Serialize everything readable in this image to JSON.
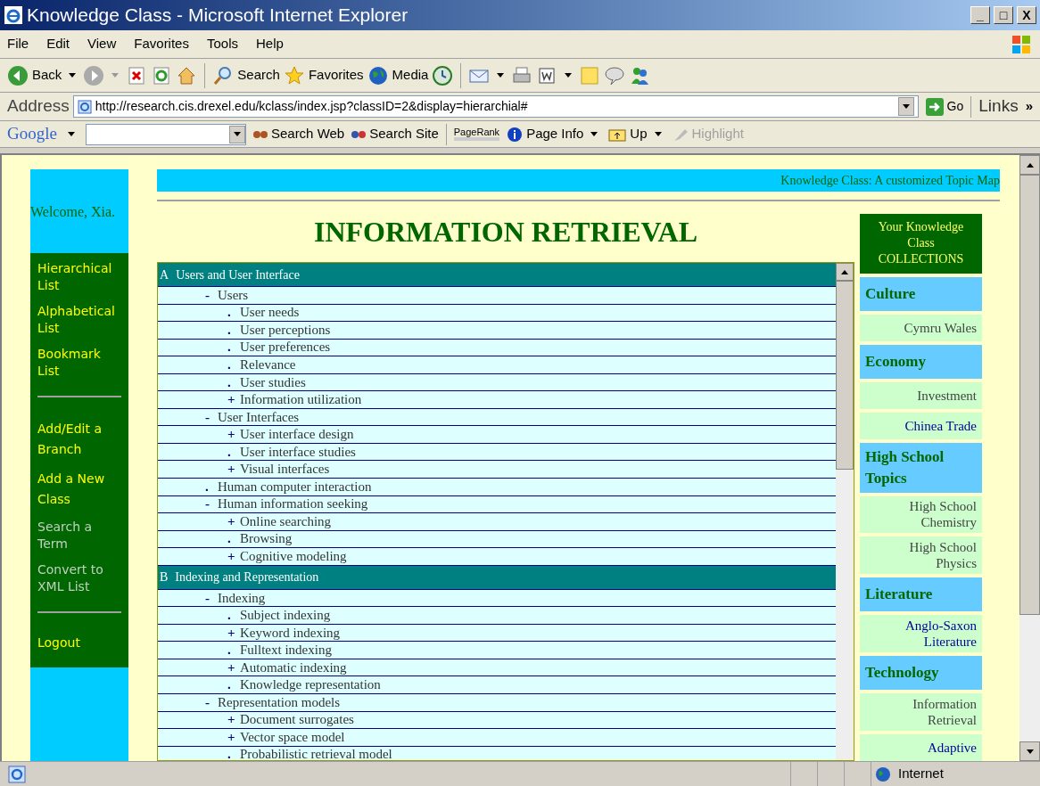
{
  "window": {
    "title": "Knowledge Class - Microsoft Internet Explorer",
    "controls": [
      "_",
      "□",
      "X"
    ]
  },
  "menu": [
    "File",
    "Edit",
    "View",
    "Favorites",
    "Tools",
    "Help"
  ],
  "toolbar": {
    "labels": [
      "Back",
      "Search",
      "Favorites",
      "Media"
    ]
  },
  "address": {
    "label": "Address",
    "url": "http://research.cis.drexel.edu/kclass/index.jsp?classID=2&display=hierarchial#",
    "go": "Go",
    "links": "Links",
    "more": "»"
  },
  "google_bar": {
    "logo": "Google",
    "items": [
      {
        "label": "Search Web",
        "disabled": false
      },
      {
        "label": "Search Site",
        "disabled": false
      },
      {
        "label": "PageRank",
        "disabled": false
      },
      {
        "label": "Page Info",
        "disabled": false
      },
      {
        "label": "Up",
        "disabled": false
      },
      {
        "label": "Highlight",
        "disabled": true
      }
    ]
  },
  "welcome": "Welcome, Xia.",
  "nav": [
    [
      {
        "label": "Hierarchical List",
        "disabled": false
      },
      {
        "label": "Alphabetical List",
        "disabled": false
      },
      {
        "label": "Bookmark List",
        "disabled": false
      }
    ],
    [
      {
        "label": "Add/Edit a Branch",
        "disabled": false
      },
      {
        "label": "Add a New Class",
        "disabled": false
      },
      {
        "label": "Search a Term",
        "disabled": true
      },
      {
        "label": "Convert to XML List",
        "disabled": true
      }
    ],
    [
      {
        "label": "Logout",
        "disabled": false
      }
    ]
  ],
  "banner": "Knowledge Class: A customized Topic Map",
  "heading": "INFORMATION RETRIEVAL",
  "tree": [
    {
      "letter": "A",
      "title": "Users and User Interface",
      "children": [
        {
          "marker": "-",
          "label": "Users",
          "children": [
            {
              "marker": ".",
              "label": "User needs"
            },
            {
              "marker": ".",
              "label": "User perceptions"
            },
            {
              "marker": ".",
              "label": "User preferences"
            },
            {
              "marker": ".",
              "label": "Relevance"
            },
            {
              "marker": ".",
              "label": "User studies"
            },
            {
              "marker": "+",
              "label": "Information utilization"
            }
          ]
        },
        {
          "marker": "-",
          "label": "User Interfaces",
          "children": [
            {
              "marker": "+",
              "label": "User interface design"
            },
            {
              "marker": ".",
              "label": "User interface studies"
            },
            {
              "marker": "+",
              "label": "Visual interfaces"
            }
          ]
        },
        {
          "marker": ".",
          "label": "Human computer interaction"
        },
        {
          "marker": "-",
          "label": "Human information seeking",
          "children": [
            {
              "marker": "+",
              "label": "Online searching"
            },
            {
              "marker": ".",
              "label": "Browsing"
            },
            {
              "marker": "+",
              "label": "Cognitive modeling"
            }
          ]
        }
      ]
    },
    {
      "letter": "B",
      "title": "Indexing and Representation",
      "children": [
        {
          "marker": "-",
          "label": "Indexing",
          "children": [
            {
              "marker": ".",
              "label": "Subject indexing"
            },
            {
              "marker": "+",
              "label": "Keyword indexing"
            },
            {
              "marker": ".",
              "label": "Fulltext indexing"
            },
            {
              "marker": "+",
              "label": "Automatic indexing"
            },
            {
              "marker": ".",
              "label": "Knowledge representation"
            }
          ]
        },
        {
          "marker": "-",
          "label": "Representation models",
          "children": [
            {
              "marker": "+",
              "label": "Document surrogates"
            },
            {
              "marker": "+",
              "label": "Vector space model"
            },
            {
              "marker": ".",
              "label": "Probabilistic retrieval model"
            }
          ]
        }
      ]
    }
  ],
  "collections": {
    "title": "Your Knowledge Class COLLECTIONS",
    "items": [
      {
        "kind": "category",
        "label": "Culture"
      },
      {
        "kind": "item",
        "label": "Cymru Wales",
        "link": false
      },
      {
        "kind": "category",
        "label": "Economy"
      },
      {
        "kind": "item",
        "label": "Investment",
        "link": false
      },
      {
        "kind": "item",
        "label": "Chinea Trade",
        "link": true
      },
      {
        "kind": "category",
        "label": "High School Topics"
      },
      {
        "kind": "item",
        "label": "High School Chemistry",
        "link": false
      },
      {
        "kind": "item",
        "label": "High School Physics",
        "link": false
      },
      {
        "kind": "category",
        "label": "Literature"
      },
      {
        "kind": "item",
        "label": "Anglo-Saxon Literature",
        "link": true
      },
      {
        "kind": "category",
        "label": "Technology"
      },
      {
        "kind": "item",
        "label": "Information Retrieval",
        "link": false
      },
      {
        "kind": "item",
        "label": "Adaptive",
        "link": true
      }
    ]
  },
  "status_bar": {
    "zone": "Internet"
  }
}
